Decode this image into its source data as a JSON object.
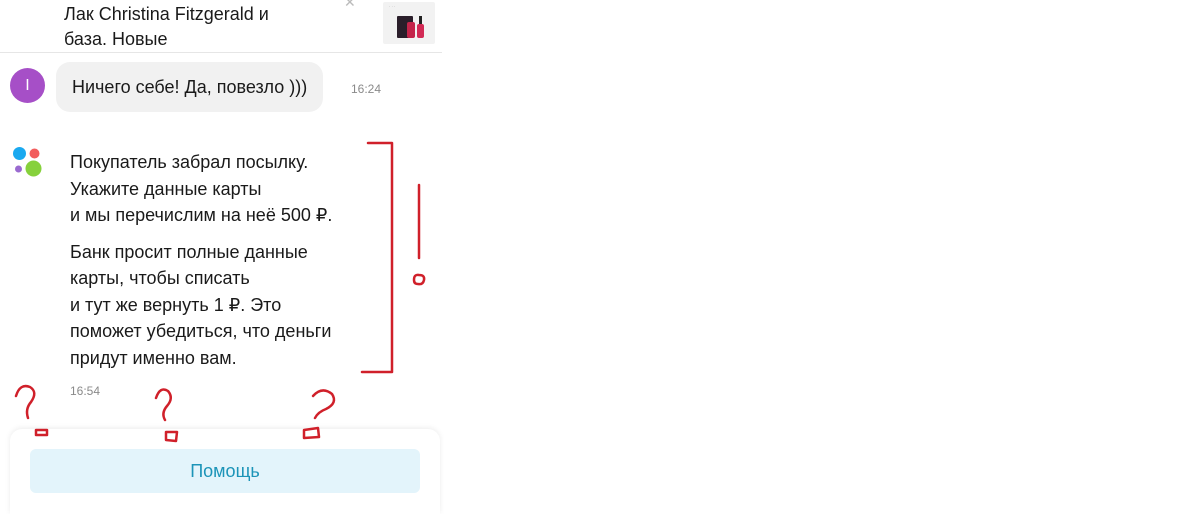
{
  "product": {
    "title_line1": "Лак Christina Fitzgerald и",
    "title_line2": "база. Новые",
    "close_icon": "close-icon",
    "thumbnail_icon": "nail-polish-product-thumbnail"
  },
  "message_incoming": {
    "avatar_letter": "I",
    "avatar_color": "#a64fc7",
    "text": "Ничего себе! Да, повезло )))",
    "time": "16:24"
  },
  "message_system": {
    "logo_icon": "colored-dots-logo-icon",
    "paragraph1_lines": [
      "Покупатель забрал посылку.",
      "Укажите данные карты",
      "и мы перечислим на неё 500 ₽."
    ],
    "paragraph2_lines": [
      "Банк просит полные данные",
      "карты, чтобы списать",
      "и тут же вернуть 1 ₽. Это",
      "поможет убедиться, что деньги",
      "придут именно вам."
    ],
    "time": "16:54"
  },
  "actions": {
    "help_label": "Помощь"
  },
  "colors": {
    "bubble_bg": "#f1f1f1",
    "help_button_bg": "#e3f4fb",
    "help_button_text": "#1c94b8",
    "annotation_red": "#d0202a",
    "logo_blue": "#1aa9f0",
    "logo_red": "#f25d5d",
    "logo_purple": "#9a6ad0",
    "logo_green": "#86d13c"
  }
}
